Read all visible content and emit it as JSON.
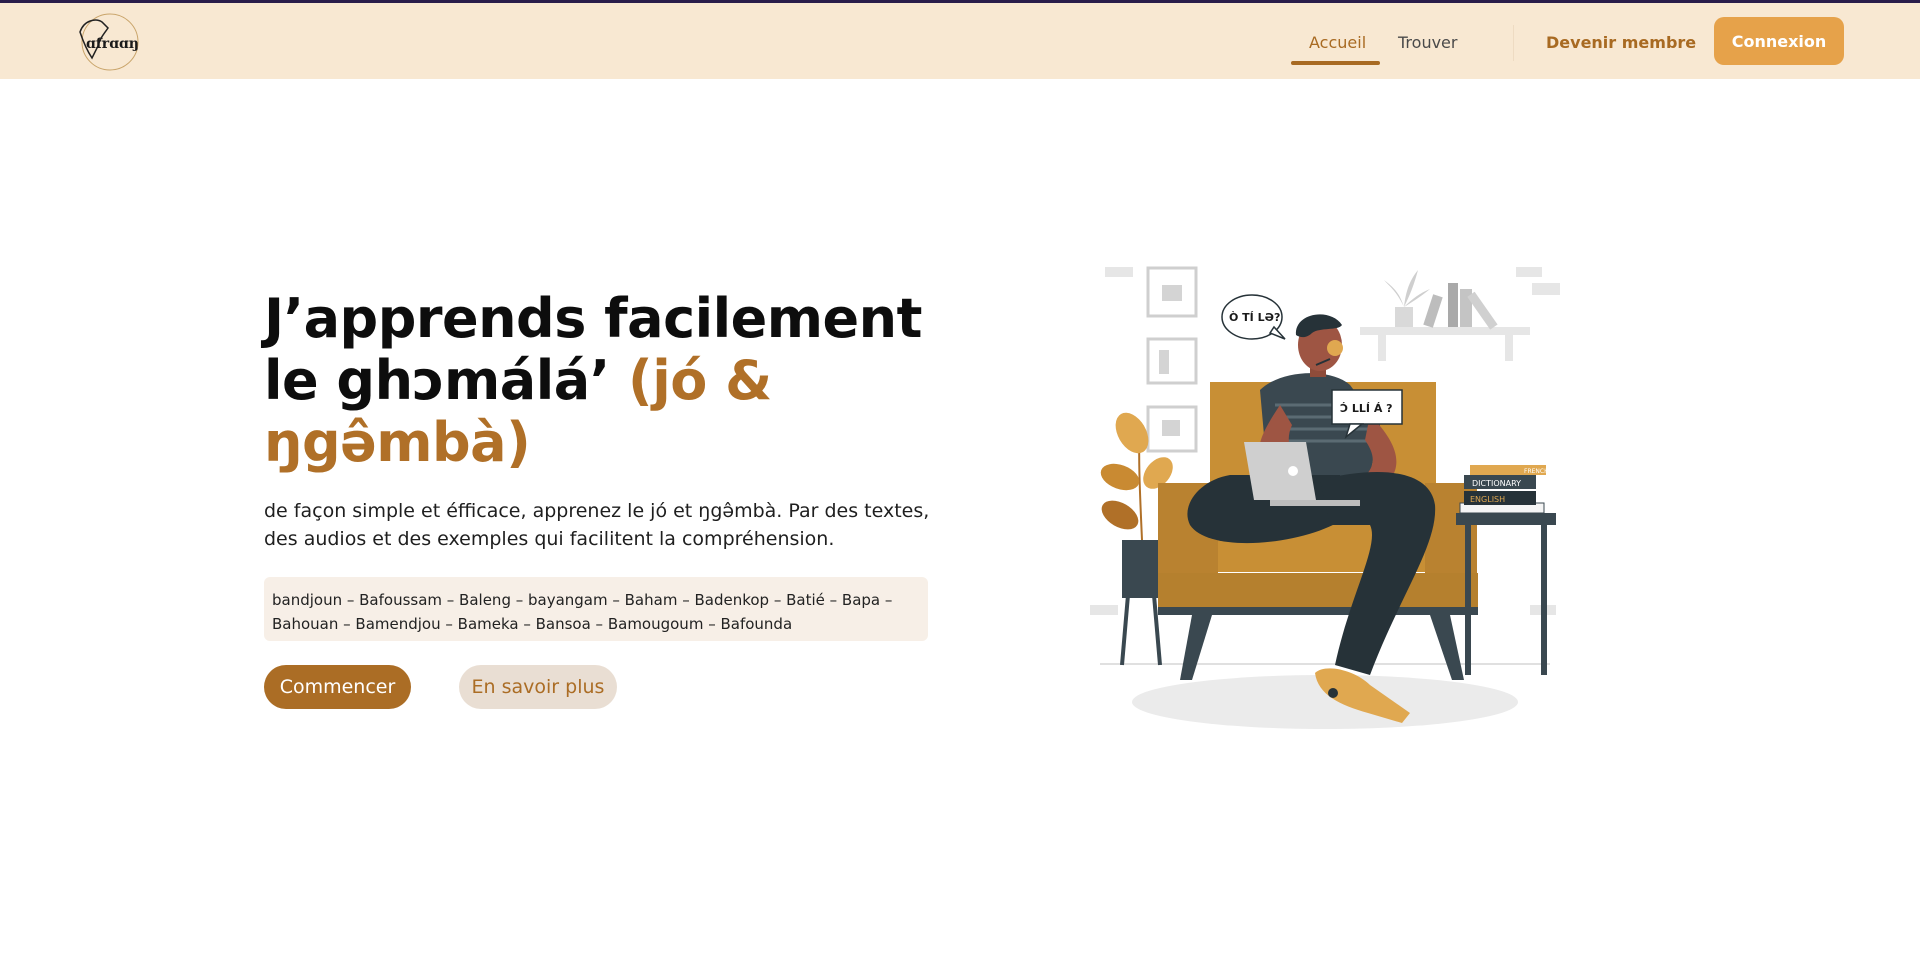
{
  "nav": {
    "logo_text": "ɑfrɑɑŋ",
    "links": [
      {
        "label": "Accueil",
        "active": true
      },
      {
        "label": "Trouver",
        "active": false
      }
    ],
    "member_label": "Devenir membre",
    "login_label": "Connexion"
  },
  "hero": {
    "title_part1": "J’apprends facilement le ghɔmálá’ ",
    "title_accent": "(jó & ŋgə̂mbà)",
    "description": "de façon simple et éfficace, apprenez le jó et ŋgə̂mbà. Par des textes, des audios et des exemples qui facilitent la compréhension.",
    "villages": "bandjoun – Bafoussam – Baleng – bayangam – Baham – Badenkop – Batié – Bapa – Bahouan – Bamendjou – Bameka – Bansoa – Bamougoum – Bafounda",
    "start_label": "Commencer",
    "more_label": "En savoir plus"
  },
  "illustration": {
    "bubble1": "Ò TÍ LƏ?",
    "bubble2": "Ɔ́ LLÍ Á ?",
    "book_top": "FRENCH",
    "book_mid": "DICTIONARY",
    "book_bottom": "ENGLISH"
  },
  "colors": {
    "nav_bg": "#f8e8d2",
    "accent": "#b07028",
    "login_bg": "#e6a24a",
    "start_bg": "#ab6d25",
    "more_bg": "#e9ded3"
  }
}
